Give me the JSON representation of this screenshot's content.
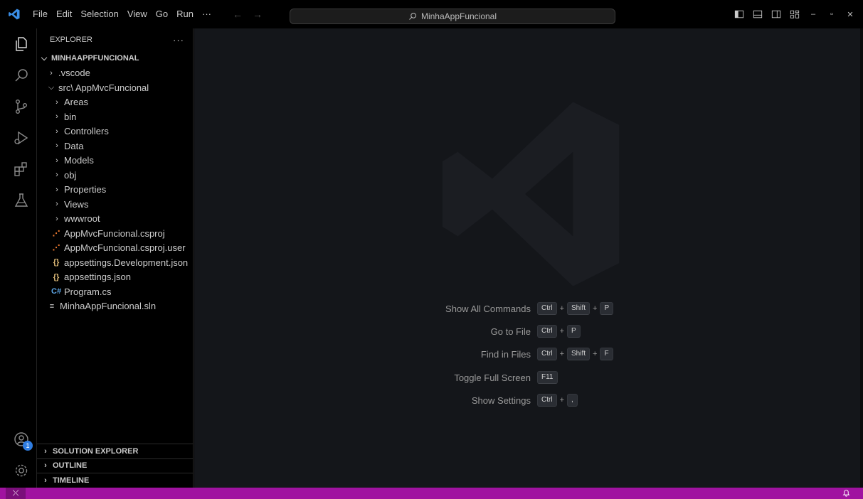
{
  "titlebar": {
    "menu": [
      "File",
      "Edit",
      "Selection",
      "View",
      "Go",
      "Run",
      "···"
    ],
    "search_text": "MinhaAppFuncional"
  },
  "explorer": {
    "title": "EXPLORER",
    "more": "···",
    "root": "MINHAAPPFUNCIONAL",
    "items": [
      {
        "label": ".vscode",
        "type": "folder",
        "expanded": false
      },
      {
        "label": "src\\ AppMvcFuncional",
        "type": "folder",
        "expanded": true
      },
      {
        "label": "Areas",
        "type": "folder",
        "expanded": false
      },
      {
        "label": "bin",
        "type": "folder",
        "expanded": false
      },
      {
        "label": "Controllers",
        "type": "folder",
        "expanded": false
      },
      {
        "label": "Data",
        "type": "folder",
        "expanded": false
      },
      {
        "label": "Models",
        "type": "folder",
        "expanded": false
      },
      {
        "label": "obj",
        "type": "folder",
        "expanded": false
      },
      {
        "label": "Properties",
        "type": "folder",
        "expanded": false
      },
      {
        "label": "Views",
        "type": "folder",
        "expanded": false
      },
      {
        "label": "wwwroot",
        "type": "folder",
        "expanded": false
      },
      {
        "label": "AppMvcFuncional.csproj",
        "type": "rss-file"
      },
      {
        "label": "AppMvcFuncional.csproj.user",
        "type": "rss-file"
      },
      {
        "label": "appsettings.Development.json",
        "type": "json-file"
      },
      {
        "label": "appsettings.json",
        "type": "json-file"
      },
      {
        "label": "Program.cs",
        "type": "csharp-file"
      },
      {
        "label": "MinhaAppFuncional.sln",
        "type": "sln-file"
      }
    ],
    "panes": [
      "SOLUTION EXPLORER",
      "OUTLINE",
      "TIMELINE"
    ]
  },
  "accounts_badge": "1",
  "shortcuts": [
    {
      "label": "Show All Commands",
      "keys": [
        "Ctrl",
        "Shift",
        "P"
      ]
    },
    {
      "label": "Go to File",
      "keys": [
        "Ctrl",
        "P"
      ]
    },
    {
      "label": "Find in Files",
      "keys": [
        "Ctrl",
        "Shift",
        "F"
      ]
    },
    {
      "label": "Toggle Full Screen",
      "keys": [
        "F11"
      ]
    },
    {
      "label": "Show Settings",
      "keys": [
        "Ctrl",
        ","
      ]
    }
  ],
  "colors": {
    "status_bar": "#a012a0",
    "editor_bg": "#14161a",
    "accent_blue": "#2f7de1"
  }
}
